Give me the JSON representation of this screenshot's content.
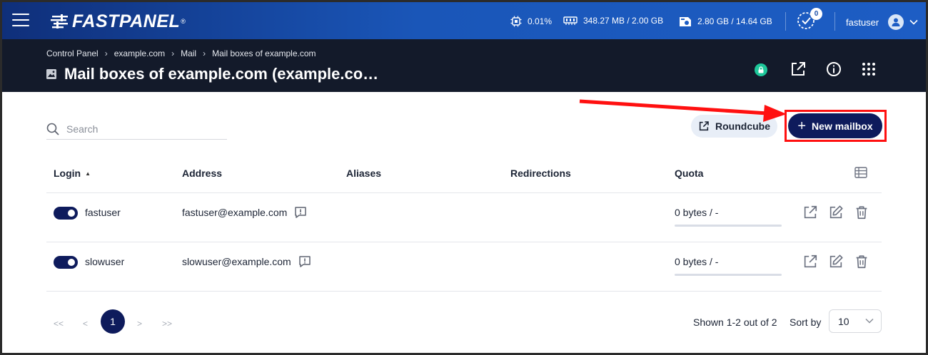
{
  "topbar": {
    "brand": "FASTPANEL",
    "brand_mark": "®",
    "cpu": "0.01%",
    "ram": "348.27 MB / 2.00 GB",
    "disk": "2.80 GB / 14.64 GB",
    "tasks_count": "0",
    "username": "fastuser"
  },
  "breadcrumb": [
    "Control Panel",
    "example.com",
    "Mail",
    "Mail boxes of example.com"
  ],
  "page": {
    "title": "Mail boxes of example.com (example.co…"
  },
  "toolbar": {
    "search_placeholder": "Search",
    "roundcube_label": "Roundcube",
    "new_mailbox_label": "New mailbox"
  },
  "table": {
    "columns": [
      "Login",
      "Address",
      "Aliases",
      "Redirections",
      "Quota"
    ],
    "rows": [
      {
        "enabled": true,
        "login": "fastuser",
        "address": "fastuser@example.com",
        "aliases": "",
        "redirections": "",
        "quota": "0 bytes / -"
      },
      {
        "enabled": true,
        "login": "slowuser",
        "address": "slowuser@example.com",
        "aliases": "",
        "redirections": "",
        "quota": "0 bytes / -"
      }
    ]
  },
  "pagination": {
    "first": "<<",
    "prev": "<",
    "current": "1",
    "next": ">",
    "last": ">>",
    "shown": "Shown 1-2 out of 2",
    "sort_label": "Sort by",
    "page_size": "10"
  },
  "colors": {
    "accent": "#0e1b5c",
    "topbar_start": "#0f2f7a",
    "topbar_end": "#1d5dc4",
    "subheader": "#131a2a",
    "annotation": "#ff1010",
    "success": "#1ec79a"
  }
}
